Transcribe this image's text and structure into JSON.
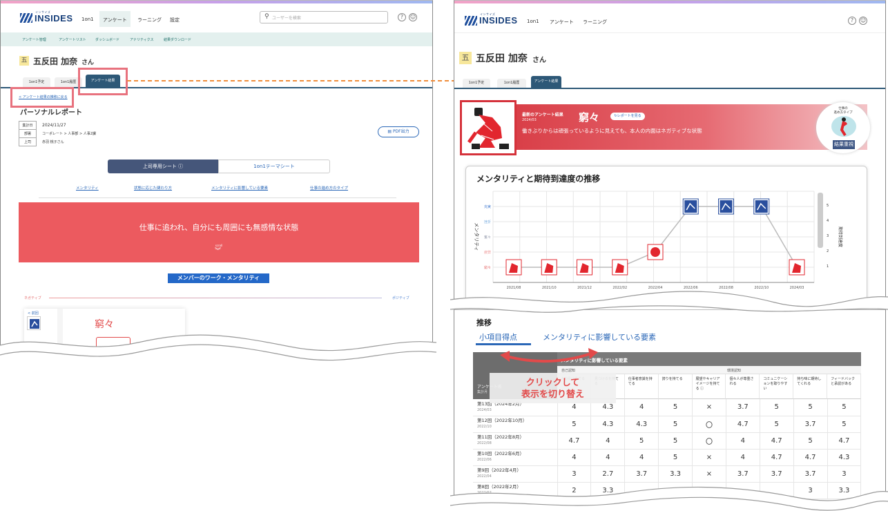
{
  "logo": {
    "kana": "インサイズ",
    "name": "INSIDES"
  },
  "left": {
    "nav": [
      "1on1",
      "アンケート",
      "ラーニング",
      "設定"
    ],
    "search_placeholder": "ユーザーを検索",
    "subnav": [
      "アンケート管理",
      "アンケートリスト",
      "ダッシュボード",
      "アナリティクス",
      "結果ダウンロード"
    ],
    "avatar_char": "五",
    "user_name": "五反田 加奈",
    "user_suffix": "さん",
    "tabs": [
      "1on1予定",
      "1on1履歴",
      "アンケート結果"
    ],
    "back_link": "< アンケート結果の推移に戻る",
    "report_title": "パーソナルレポート",
    "info": [
      {
        "label": "集計日",
        "value": "2024/11/27"
      },
      {
        "label": "部署",
        "value": "コーポレート > 人事部 > 人事2課"
      },
      {
        "label": "上司",
        "value": "赤羽 桃子さん"
      }
    ],
    "pdf_label": "PDF出力",
    "sheet_tabs": [
      "上司専用シート",
      "1on1テーマシート"
    ],
    "anchors": [
      "メンタリティ",
      "状態に応じた関わり方",
      "メンタリティに影響している要素",
      "仕事の進め方のタイプ"
    ],
    "banner_text": "仕事に追われ、自分にも周囲にも無感情な状態",
    "scroll_label": "scroll",
    "section_label": "メンバーのワーク・メンタリティ",
    "axis_left": "ネガティブ",
    "axis_right": "ポジティブ",
    "card_prev": "< 前回",
    "card_type": "窮々"
  },
  "right": {
    "nav": [
      "1on1",
      "アンケート",
      "ラーニング"
    ],
    "avatar_char": "五",
    "user_name": "五反田 加奈",
    "user_suffix": "さん",
    "tabs": [
      "1on1予定",
      "1on1履歴",
      "アンケート結果"
    ],
    "latest_label": "最新のアンケート結果",
    "latest_date": "2024/03",
    "type_name": "窮々",
    "report_btn": "レポートを見る",
    "type_desc": "働きぶりからは頑張っているように見えても、本人の内面はネガティブな状態",
    "work_type_label": "仕事の\n進め方タイプ",
    "work_type_value": "結果重視",
    "chart_title": "メンタリティと期待到達度の推移",
    "trend_label": "推移",
    "tabs2": [
      "小項目得点",
      "メンタリティに影響している要素"
    ],
    "table_header_main": "メンタリティに影響している要素",
    "table_group1": "自己認知",
    "table_group2": "環境認知",
    "col_first": "アンケート名",
    "col_first_sub": "集計月",
    "columns": [
      "人の役に立てる",
      "見つけるを持てる",
      "仕事者意識を持てる",
      "誇りを持てる",
      "展望やキャリアイメージを持てる ⓘ",
      "個々人が尊重される",
      "コミュニケーションを取りやすい",
      "持ち味に期待してくれる",
      "フィードバックと承認がある"
    ],
    "rows": [
      {
        "name": "第13回（2024年2月）",
        "date": "2024/03",
        "vals": [
          "4",
          "4.3",
          "4",
          "5",
          "×",
          "3.7",
          "5",
          "5",
          "5"
        ]
      },
      {
        "name": "第12回（2022年10月）",
        "date": "2022/10",
        "vals": [
          "5",
          "4.3",
          "4.3",
          "5",
          "〇",
          "4.7",
          "5",
          "3.7",
          "5"
        ]
      },
      {
        "name": "第11回（2022年8月）",
        "date": "2022/08",
        "vals": [
          "4.7",
          "4",
          "5",
          "5",
          "〇",
          "4",
          "4.7",
          "5",
          "4.7"
        ]
      },
      {
        "name": "第10回（2022年6月）",
        "date": "2022/06",
        "vals": [
          "4",
          "4",
          "4",
          "5",
          "×",
          "4",
          "4.7",
          "4.7",
          "4.3"
        ]
      },
      {
        "name": "第9回（2022年4月）",
        "date": "2022/04",
        "vals": [
          "3",
          "2.7",
          "3.7",
          "3.3",
          "×",
          "3.7",
          "3.7",
          "3.7",
          "3"
        ]
      },
      {
        "name": "第8回（2022年2月）",
        "date": "2022/02",
        "vals": [
          "2",
          "3.3",
          "",
          "4",
          "",
          "",
          "",
          "3",
          "3.3"
        ]
      }
    ]
  },
  "callout": "クリックして\n表示を切り替え",
  "chart_data": {
    "type": "line",
    "title": "メンタリティと期待到達度の推移",
    "x": [
      "2021/08",
      "2021/10",
      "2021/12",
      "2022/02",
      "2022/04",
      "2022/06",
      "2022/08",
      "2022/10",
      "2024/03"
    ],
    "ylabel": "メンタリティ",
    "y_categories": [
      "充実",
      "挫折",
      "奮々",
      "疲弊",
      "窮々"
    ],
    "y2label": "期待到達度",
    "y2_ticks": [
      1,
      2,
      3,
      4,
      5
    ],
    "series": [
      {
        "values": [
          "窮々",
          "窮々",
          "窮々",
          "窮々",
          "疲弊",
          "充実",
          "充実",
          "充実",
          "窮々"
        ]
      }
    ],
    "grid": true
  }
}
